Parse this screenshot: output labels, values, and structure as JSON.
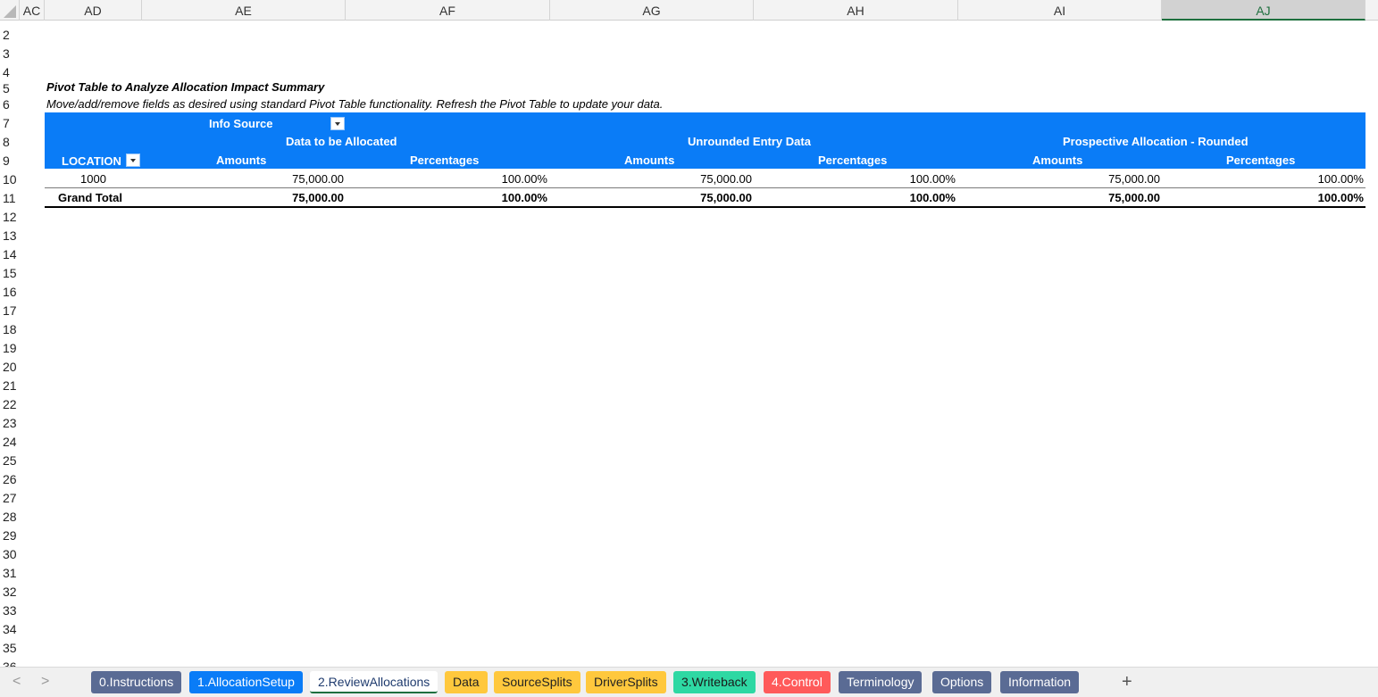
{
  "columns": [
    "AC",
    "AD",
    "AE",
    "AF",
    "AG",
    "AH",
    "AI",
    "AJ"
  ],
  "rows": [
    "2",
    "3",
    "4",
    "5",
    "6",
    "7",
    "8",
    "9",
    "10",
    "11",
    "12",
    "13",
    "14",
    "15",
    "16",
    "17",
    "18",
    "19",
    "20",
    "21",
    "22",
    "23",
    "24",
    "25",
    "26",
    "27",
    "28",
    "29",
    "30",
    "31",
    "32",
    "33",
    "34",
    "35",
    "36"
  ],
  "sheet": {
    "title": "Pivot Table to Analyze Allocation Impact Summary",
    "subtitle": "Move/add/remove fields as desired using standard Pivot Table functionality. Refresh the Pivot Table to update your data."
  },
  "pivot": {
    "column_field": "Info Source",
    "row_field": "LOCATION",
    "groups": [
      "Data to be Allocated",
      "Unrounded Entry Data",
      "Prospective Allocation - Rounded"
    ],
    "measures": [
      "Amounts",
      "Percentages"
    ],
    "rows": [
      {
        "label": "1000",
        "values": [
          "75,000.00",
          "100.00%",
          "75,000.00",
          "100.00%",
          "75,000.00",
          "100.00%"
        ]
      }
    ],
    "total": {
      "label": "Grand Total",
      "values": [
        "75,000.00",
        "100.00%",
        "75,000.00",
        "100.00%",
        "75,000.00",
        "100.00%"
      ]
    }
  },
  "tabs": [
    {
      "label": "0.Instructions",
      "bg": "#5a6b94",
      "fg": "#ffffff"
    },
    {
      "label": "1.AllocationSetup",
      "bg": "#0a7cf7",
      "fg": "#ffffff"
    },
    {
      "label": "2.ReviewAllocations",
      "bg": "#ffffff",
      "fg": "#1f3b6e",
      "active": true
    },
    {
      "label": "Data",
      "bg": "#ffc83d",
      "fg": "#222222"
    },
    {
      "label": "SourceSplits",
      "bg": "#ffc83d",
      "fg": "#222222"
    },
    {
      "label": "DriverSplits",
      "bg": "#ffc83d",
      "fg": "#222222"
    },
    {
      "label": "3.Writeback",
      "bg": "#2ed8a3",
      "fg": "#1a1a1a"
    },
    {
      "label": "4.Control",
      "bg": "#ff5a5a",
      "fg": "#ffffff"
    },
    {
      "label": "Terminology",
      "bg": "#5a6b94",
      "fg": "#ffffff"
    },
    {
      "label": "Options",
      "bg": "#5a6b94",
      "fg": "#ffffff"
    },
    {
      "label": "Information",
      "bg": "#5a6b94",
      "fg": "#ffffff"
    }
  ],
  "nav": {
    "prev": "<",
    "next": ">",
    "add": "+"
  },
  "colors": {
    "pivot_header": "#0a7cf7",
    "selected_column": "#1e6f3e"
  }
}
